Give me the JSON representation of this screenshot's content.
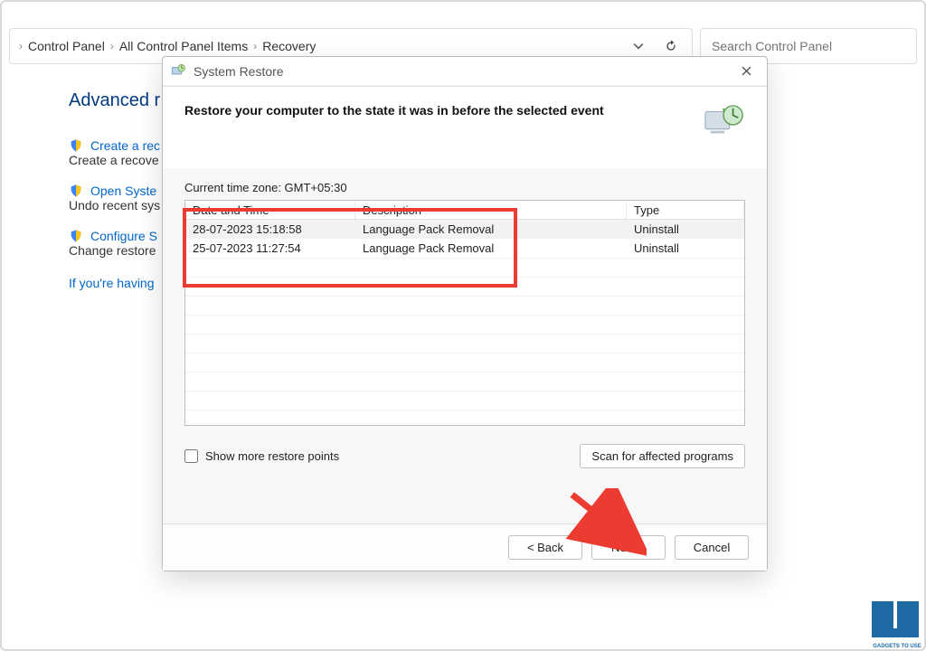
{
  "breadcrumbs": {
    "a": "Control Panel",
    "b": "All Control Panel Items",
    "c": "Recovery"
  },
  "search": {
    "placeholder": "Search Control Panel"
  },
  "page": {
    "heading_visible": "Advanced r",
    "link1": "Create a rec",
    "sub1": "Create a recove",
    "link2": "Open Syste",
    "sub2": "Undo recent sys",
    "link3": "Configure S",
    "sub3": "Change restore",
    "help_line": "If you're having"
  },
  "dialog": {
    "title": "System Restore",
    "headline": "Restore your computer to the state it was in before the selected event",
    "timezone_label": "Current time zone: GMT+05:30",
    "columns": {
      "c1": "Date and Time",
      "c2": "Description",
      "c3": "Type"
    },
    "rows": [
      {
        "dt": "28-07-2023 15:18:58",
        "desc": "Language Pack Removal",
        "type": "Uninstall"
      },
      {
        "dt": "25-07-2023 11:27:54",
        "desc": "Language Pack Removal",
        "type": "Uninstall"
      }
    ],
    "show_more_label": "Show more restore points",
    "scan_label": "Scan for affected programs",
    "back_label": "< Back",
    "next_label": "Next >",
    "cancel_label": "Cancel"
  }
}
